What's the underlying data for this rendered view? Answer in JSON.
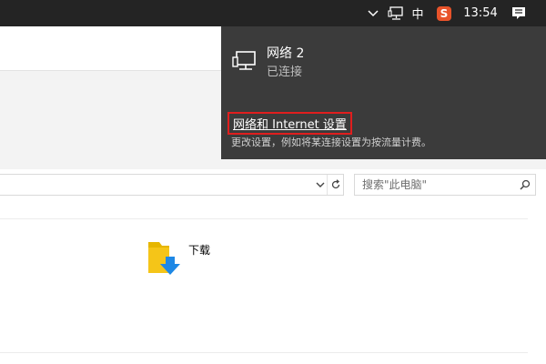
{
  "taskbar": {
    "ime_label": "中",
    "sogou_label": "S",
    "clock": "13:54",
    "icons": [
      "chevron-up-icon",
      "network-icon",
      "sogou-ime-icon",
      "action-center-icon"
    ]
  },
  "flyout": {
    "network_name": "网络 2",
    "network_status": "已连接",
    "settings_link": "网络和 Internet 设置",
    "settings_description": "更改设置，例如将某连接设置为按流量计费。"
  },
  "explorer": {
    "search_placeholder": "搜索\"此电脑\"",
    "folder_label": "下载"
  },
  "colors": {
    "taskbar_bg": "#242424",
    "flyout_bg": "#3b3b3b",
    "highlight_border": "#e01e1e",
    "sogou_accent": "#e8532a",
    "folder_yellow": "#f5c518",
    "download_blue": "#1e88e5"
  }
}
